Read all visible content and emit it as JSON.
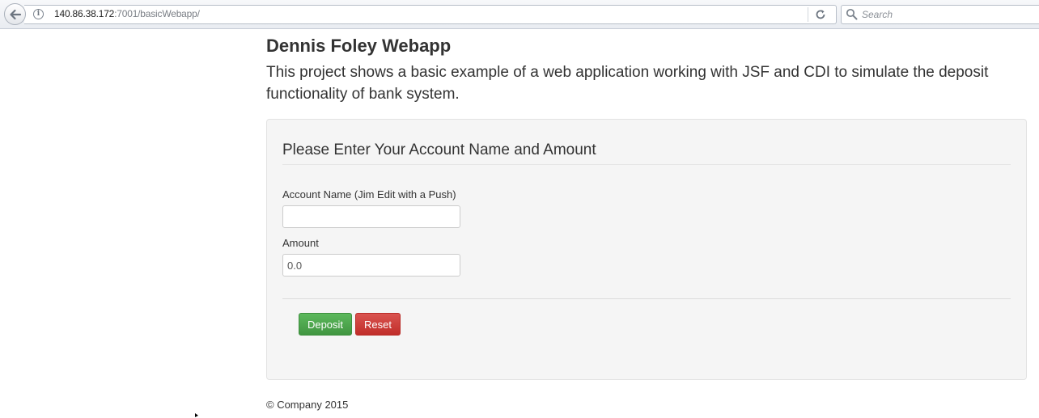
{
  "browser": {
    "url_host": "140.86.38.172",
    "url_rest": ":7001/basicWebapp/",
    "search_placeholder": "Search",
    "info_glyph": "i"
  },
  "page": {
    "title": "Dennis Foley Webapp",
    "description": "This project shows a basic example of a web application working with JSF and CDI to simulate the deposit functionality of bank system."
  },
  "form": {
    "heading": "Please Enter Your Account Name and Amount",
    "account_name_label": "Account Name (Jim Edit with a Push)",
    "account_name_value": "",
    "amount_label": "Amount",
    "amount_value": "0.0",
    "deposit_label": "Deposit",
    "reset_label": "Reset"
  },
  "footer": {
    "text": "© Company 2015"
  },
  "colors": {
    "deposit": "#5cb85c",
    "reset": "#d9534f",
    "panel_bg": "#f5f5f5"
  }
}
